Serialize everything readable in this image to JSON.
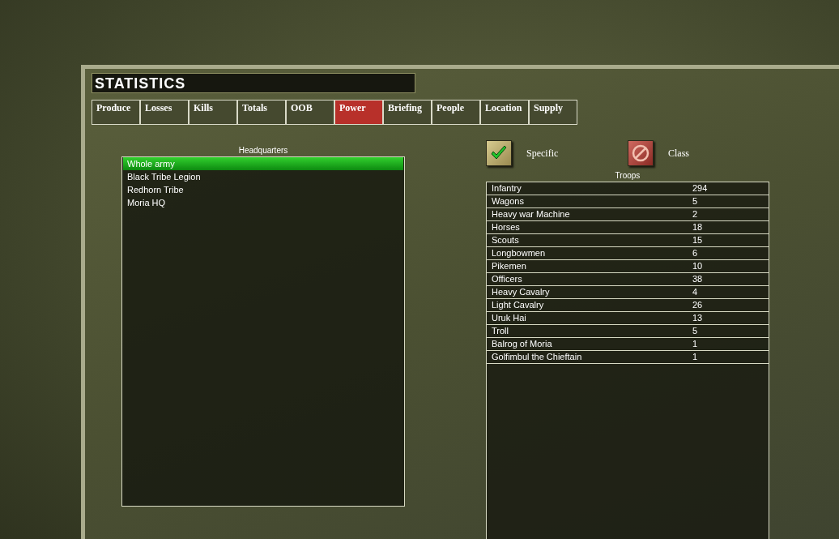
{
  "title": "STATISTICS",
  "tabs": [
    {
      "label": "Produce",
      "selected": false
    },
    {
      "label": "Losses",
      "selected": false
    },
    {
      "label": "Kills",
      "selected": false
    },
    {
      "label": "Totals",
      "selected": false
    },
    {
      "label": "OOB",
      "selected": false
    },
    {
      "label": "Power",
      "selected": true
    },
    {
      "label": "Briefing",
      "selected": false
    },
    {
      "label": "People",
      "selected": false
    },
    {
      "label": "Location",
      "selected": false
    },
    {
      "label": "Supply",
      "selected": false
    }
  ],
  "headquarters": {
    "heading": "Headquarters",
    "items": [
      {
        "label": "Whole army",
        "selected": true
      },
      {
        "label": "Black Tribe Legion",
        "selected": false
      },
      {
        "label": "Redhorn Tribe",
        "selected": false
      },
      {
        "label": "Moria HQ",
        "selected": false
      }
    ]
  },
  "filters": [
    {
      "kind": "check",
      "label": "Specific"
    },
    {
      "kind": "ban",
      "label": "Class"
    }
  ],
  "troops": {
    "heading": "Troops",
    "rows": [
      {
        "name": "Infantry",
        "count": "294"
      },
      {
        "name": "Wagons",
        "count": "5"
      },
      {
        "name": "Heavy war Machine",
        "count": "2"
      },
      {
        "name": "Horses",
        "count": "18"
      },
      {
        "name": "Scouts",
        "count": "15"
      },
      {
        "name": "Longbowmen",
        "count": "6"
      },
      {
        "name": "Pikemen",
        "count": "10"
      },
      {
        "name": "Officers",
        "count": "38"
      },
      {
        "name": "Heavy Cavalry",
        "count": "4"
      },
      {
        "name": "Light Cavalry",
        "count": "26"
      },
      {
        "name": "Uruk Hai",
        "count": "13"
      },
      {
        "name": "Troll",
        "count": "5"
      },
      {
        "name": "Balrog of Moria",
        "count": "1"
      },
      {
        "name": "Golfimbul the Chieftain",
        "count": "1"
      }
    ]
  }
}
